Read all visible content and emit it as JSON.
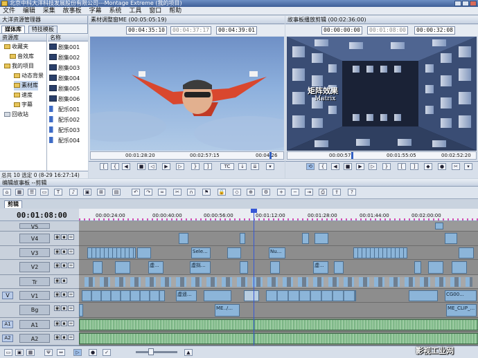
{
  "window": {
    "title": "北京中科大洋科技发展股份有限公司---Montage Extreme (我的项目)"
  },
  "menu": [
    "文件",
    "编辑",
    "采集",
    "故事板",
    "字幕",
    "系统",
    "工具",
    "窗口",
    "帮助"
  ],
  "resource_manager": {
    "title": "大洋资源管理器",
    "tabs": [
      "媒体库",
      "特技模板"
    ],
    "tree_header": "资源库",
    "tree": [
      {
        "label": "收藏夹",
        "level": 1
      },
      {
        "label": "音效库",
        "level": 2
      },
      {
        "label": "我的项目",
        "level": 1
      },
      {
        "label": "动态背景",
        "level": 2
      },
      {
        "label": "素材库",
        "level": 2
      },
      {
        "label": "速度",
        "level": 2
      },
      {
        "label": "字幕",
        "level": 2
      },
      {
        "label": "回收站",
        "level": 1
      }
    ],
    "list_header": "名称",
    "items": [
      {
        "label": "剧集001",
        "kind": "video"
      },
      {
        "label": "剧集002",
        "kind": "video"
      },
      {
        "label": "剧集003",
        "kind": "video"
      },
      {
        "label": "剧集004",
        "kind": "video"
      },
      {
        "label": "剧集005",
        "kind": "video"
      },
      {
        "label": "剧集006",
        "kind": "video"
      },
      {
        "label": "配乐001",
        "kind": "audio"
      },
      {
        "label": "配乐002",
        "kind": "audio"
      },
      {
        "label": "配乐003",
        "kind": "audio"
      },
      {
        "label": "配乐004",
        "kind": "audio"
      }
    ],
    "status": "总共 10  选定 0  (8-29 16:27:14)"
  },
  "source_monitor": {
    "title": "素材调整窗ME (00:05:05:19)",
    "tc_in": "00:04:35:10",
    "tc_dur": "00:04:37:17",
    "tc_out": "00:04:39:01",
    "ruler": [
      "00:01:28:20",
      "00:02:57:15",
      "00:04:26"
    ]
  },
  "program_monitor": {
    "title": "故事板播放剪辑 (00:02:36:00)",
    "tc_in": "00:00:00:00",
    "tc_dur": "00:01:08:00",
    "tc_out": "00:00:32:08",
    "overlay_cn": "矩阵效果",
    "overlay_en": "Matrix",
    "ruler": [
      "00:00:57",
      "00:01:55:05",
      "00:02:52:20"
    ]
  },
  "timeline": {
    "title": "编辑故事板 --剪辑",
    "tab": "剪辑",
    "timecode": "00:01:08:00",
    "ruler": [
      "00:00:24:00",
      "00:00:40:00",
      "00:00:56:00",
      "00:01:12:00",
      "00:01:28:00",
      "00:01:44:00",
      "00:02:00:00"
    ],
    "group_v": "V",
    "group_a1": "A1",
    "group_a2": "A2",
    "tracks": [
      {
        "name": "V5",
        "type": "video"
      },
      {
        "name": "V4",
        "type": "video"
      },
      {
        "name": "V3",
        "type": "video"
      },
      {
        "name": "V2",
        "type": "video"
      },
      {
        "name": "Tr",
        "type": "trans"
      },
      {
        "name": "V1",
        "type": "video"
      },
      {
        "name": "Bg",
        "type": "video"
      },
      {
        "name": "A1",
        "type": "audio"
      },
      {
        "name": "A2",
        "type": "audio"
      }
    ],
    "clip_labels": {
      "v3_a": "Sele...",
      "v3_b": "Nu...",
      "v2_a": "虚...",
      "v2_b": "虚拟...",
      "v2_c": "虚...",
      "v1_a": "虚遥...",
      "v1_b": "CG00...",
      "bg_a": "ME../...",
      "bg_b": "ME_CLIP_..."
    }
  },
  "watermark": "影视工业网"
}
